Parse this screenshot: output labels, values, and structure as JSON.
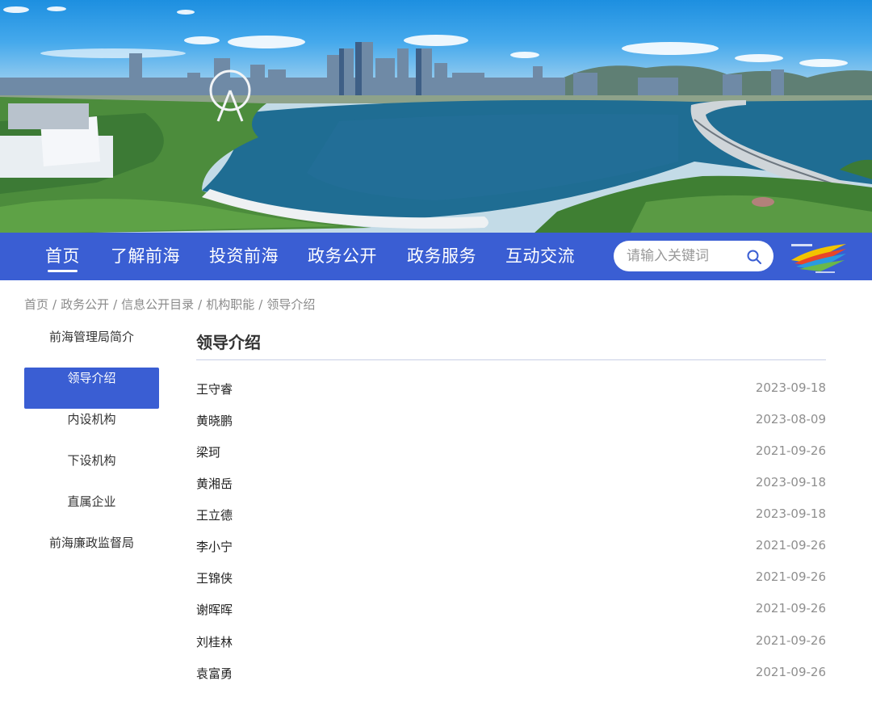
{
  "nav": {
    "items": [
      "首页",
      "了解前海",
      "投资前海",
      "政务公开",
      "政务服务",
      "互动交流"
    ],
    "active_index": 0
  },
  "search": {
    "placeholder": "请输入关键词"
  },
  "breadcrumb": [
    "首页",
    "政务公开",
    "信息公开目录",
    "机构职能",
    "领导介绍"
  ],
  "breadcrumb_separator": "/",
  "sidebar": {
    "items": [
      "前海管理局简介",
      "领导介绍",
      "内设机构",
      "下设机构",
      "直属企业",
      "前海廉政监督局"
    ],
    "active_index": 1
  },
  "main": {
    "title": "领导介绍",
    "rows": [
      {
        "name": "王守睿",
        "date": "2023-09-18"
      },
      {
        "name": "黄晓鹏",
        "date": "2023-08-09"
      },
      {
        "name": "梁珂",
        "date": "2021-09-26"
      },
      {
        "name": "黄湘岳",
        "date": "2023-09-18"
      },
      {
        "name": "王立德",
        "date": "2023-09-18"
      },
      {
        "name": "李小宁",
        "date": "2021-09-26"
      },
      {
        "name": "王锦侠",
        "date": "2021-09-26"
      },
      {
        "name": "谢晖晖",
        "date": "2021-09-26"
      },
      {
        "name": "刘桂林",
        "date": "2021-09-26"
      },
      {
        "name": "袁富勇",
        "date": "2021-09-26"
      }
    ]
  },
  "colors": {
    "brand_blue": "#3a5ed3",
    "text_dark": "#333333",
    "date_gray": "#8f8f8f",
    "breadcrumb_gray": "#8a8a8a"
  },
  "icons": {
    "search": "search-icon",
    "logo": "qianhai-logo"
  }
}
